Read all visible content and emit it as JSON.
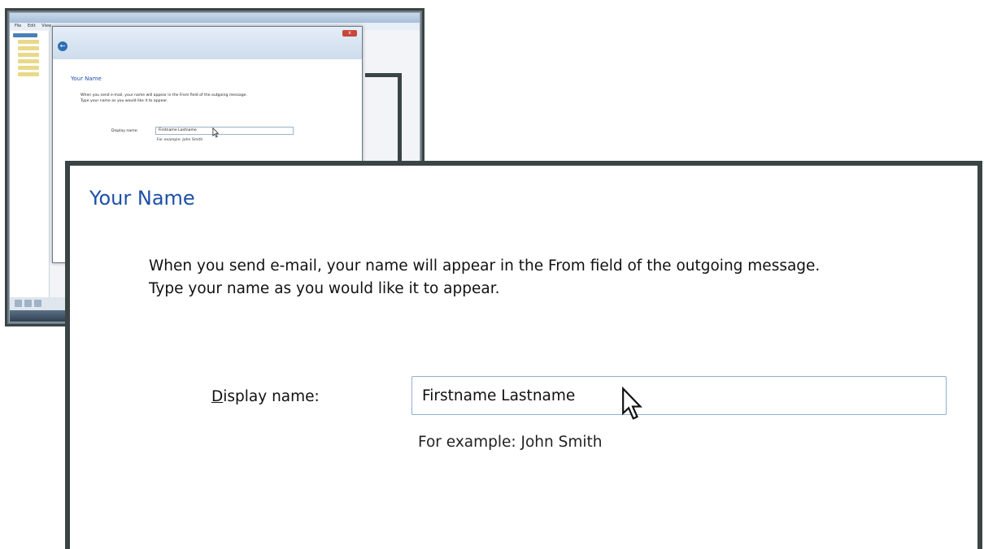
{
  "thumbnail": {
    "menu": [
      "File",
      "Edit",
      "View"
    ],
    "dialog": {
      "close_glyph": "x",
      "title": "Your Name",
      "description_line1": "When you send e-mail, your name will appear in the From field of the outgoing message.",
      "description_line2": "Type your name as you would like it to appear.",
      "field_label": "Display name:",
      "field_value": "Firstname Lastname",
      "example_text": "For example: John Smith"
    }
  },
  "callout": {
    "title": "Your Name",
    "description_line1": "When you send e-mail, your name will appear in the From field of the outgoing message.",
    "description_line2": "Type your name as you would like it to appear.",
    "field_label_accel": "D",
    "field_label_rest": "isplay name:",
    "field_value": "Firstname Lastname",
    "example_text": "For example: John Smith"
  },
  "colors": {
    "title_blue": "#1e4fa8",
    "frame_dark": "#3a4444",
    "input_border": "#8fb0cf"
  },
  "icons": {
    "back": "back-arrow-icon",
    "close": "close-icon",
    "cursor": "mouse-pointer-icon"
  }
}
